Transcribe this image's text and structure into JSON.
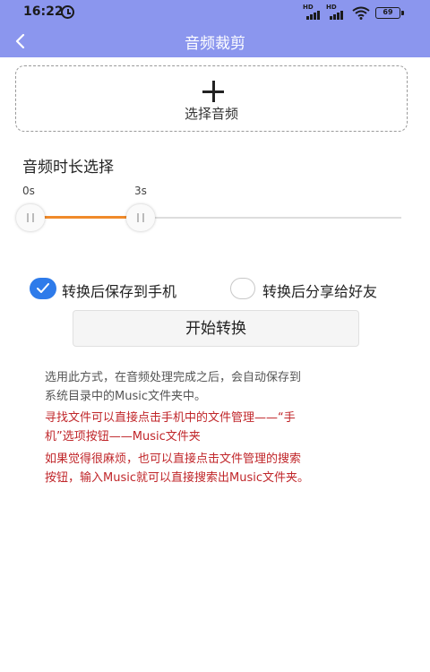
{
  "status_bar": {
    "time": "16:22",
    "signal1_label": "HD",
    "signal2_label": "HD",
    "battery": "69"
  },
  "header": {
    "title": "音频裁剪",
    "background_color": "#8b96ee"
  },
  "select_audio": {
    "label": "选择音频",
    "icon": "plus-icon"
  },
  "duration": {
    "title": "音频时长选择",
    "start_label": "0s",
    "end_label": "3s",
    "range_seconds": [
      0,
      3
    ],
    "fill_color": "#f08a2a"
  },
  "options": [
    {
      "label": "转换后保存到手机",
      "checked": true
    },
    {
      "label": "转换后分享给好友",
      "checked": false
    }
  ],
  "start_button": {
    "label": "开始转换"
  },
  "info": {
    "line1": "选用此方式，在音频处理完成之后，会自动保存到",
    "line2": "系统目录中的Music文件夹中。",
    "tip1_line1": "寻找文件可以直接点击手机中的文件管理——“手",
    "tip1_line2": "机”选项按钮——Music文件夹",
    "tip2_line1": "如果觉得很麻烦，也可以直接点击文件管理的搜索",
    "tip2_line2": "按钮，输入Music就可以直接搜索出Music文件夹。",
    "tip_color": "#c0262a"
  }
}
